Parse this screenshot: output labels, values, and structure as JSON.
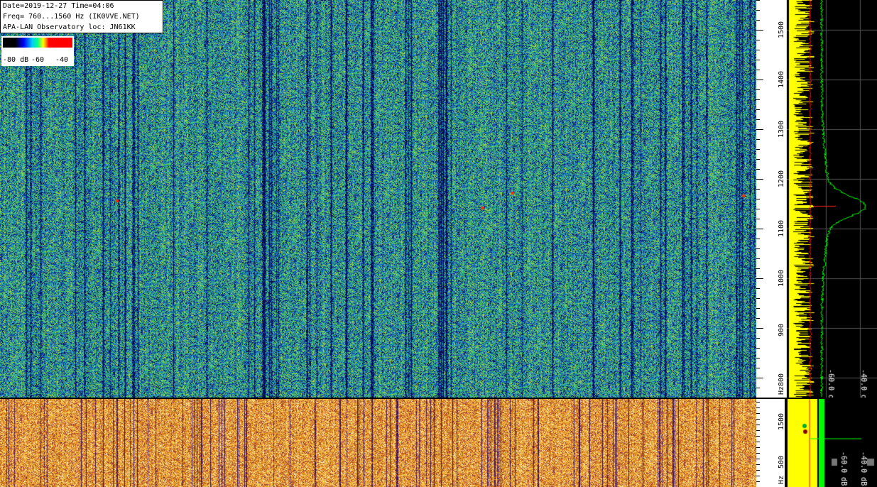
{
  "info": {
    "line1": "Date=2019-12-27 Time=04:06",
    "line2": "Freq= 760...1560 Hz (IK0VVE.NET)",
    "line3": "APA-LAN Observatory loc: JN61KK"
  },
  "colorbar": {
    "label_min": "-80 dB",
    "label_mid": "-60",
    "label_max": "-40"
  },
  "freq_scale_top": {
    "ticks": [
      "1500",
      "1400",
      "1300",
      "1200",
      "1100",
      "1000",
      "900",
      "800"
    ],
    "unit": "Hz"
  },
  "freq_scale_bottom": {
    "ticks": [
      "1500",
      "500"
    ],
    "unit": "Hz"
  },
  "spectrum_top_labels": [
    "-60.0 dB",
    "-40.0 dB"
  ],
  "spectrum_bottom_labels": [
    "-60.0 dB",
    "-40.0 dB"
  ],
  "colors": {
    "waterfall_bg": "#2a8c6a",
    "waterfall_bottom": "#e59a2a",
    "spectrum_bg": "#000000",
    "trace_yellow": "#ffff00",
    "trace_green": "#00ff00",
    "trace_red": "#ff0000"
  }
}
